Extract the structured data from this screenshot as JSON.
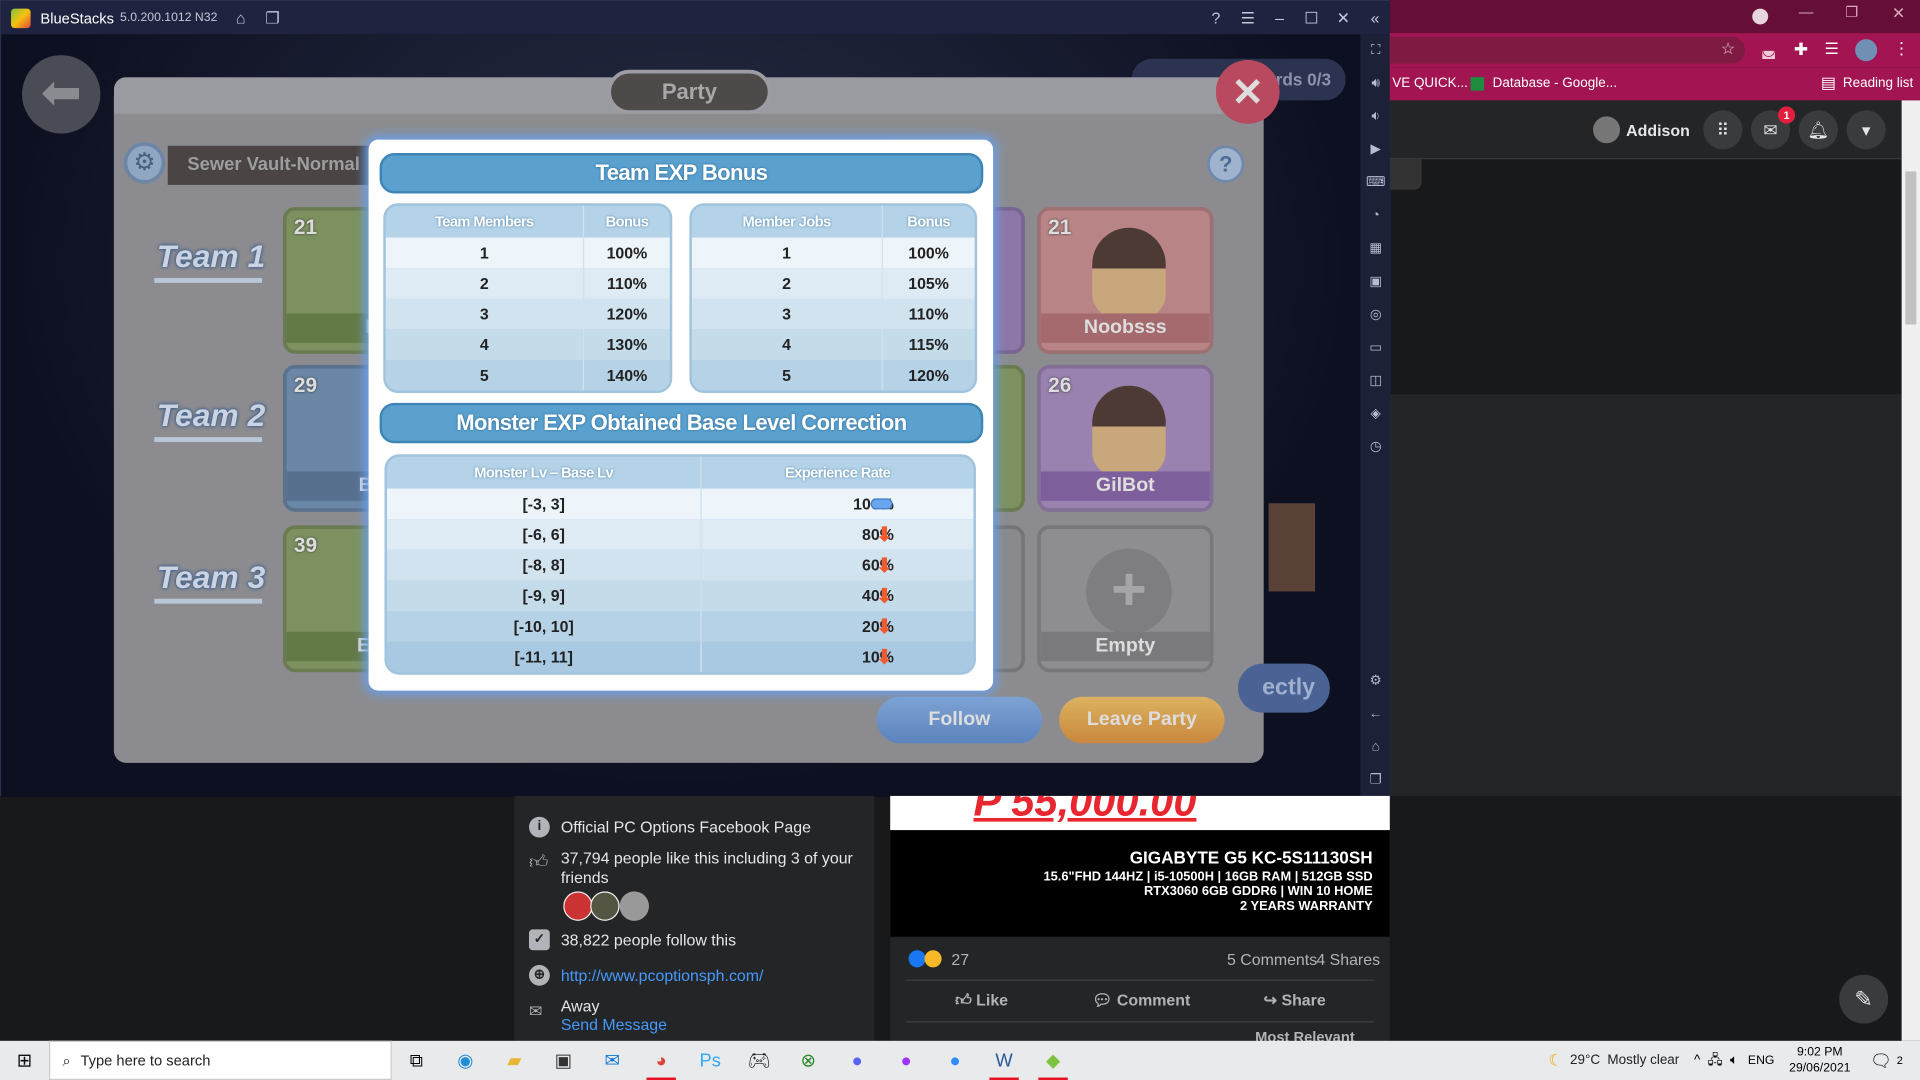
{
  "bluestacks": {
    "app_name": "BlueStacks",
    "version": "5.0.200.1012 N32"
  },
  "game": {
    "title": "Party",
    "dungeon": "Sewer Vault-Normal",
    "rewards": "rds 0/3",
    "teams": [
      "Team 1",
      "Team 2",
      "Team 3"
    ],
    "left_cards": [
      {
        "level": "21",
        "name": "E"
      },
      {
        "level": "29",
        "name": "Bo"
      },
      {
        "level": "39",
        "name": "EM"
      }
    ],
    "right_cards": [
      {
        "level": "21",
        "name": "Noobsss"
      },
      {
        "level": "26",
        "name": "GilBot"
      },
      {
        "level": "",
        "name": "Empty"
      }
    ],
    "follow": "Follow",
    "leave_party": "Leave Party",
    "partial_button": "ectly"
  },
  "modal": {
    "title": "Team EXP Bonus",
    "members_table": {
      "headers": [
        "Team Members",
        "Bonus"
      ],
      "rows": [
        [
          "1",
          "100%"
        ],
        [
          "2",
          "110%"
        ],
        [
          "3",
          "120%"
        ],
        [
          "4",
          "130%"
        ],
        [
          "5",
          "140%"
        ]
      ]
    },
    "jobs_table": {
      "headers": [
        "Member Jobs",
        "Bonus"
      ],
      "rows": [
        [
          "1",
          "100%"
        ],
        [
          "2",
          "105%"
        ],
        [
          "3",
          "110%"
        ],
        [
          "4",
          "115%"
        ],
        [
          "5",
          "120%"
        ]
      ]
    },
    "correction_title": "Monster EXP Obtained Base Level Correction",
    "correction_table": {
      "headers": [
        "Monster Lv – Base Lv",
        "Experience Rate"
      ],
      "rows": [
        {
          "range": "[-3, 3]",
          "rate": "100%",
          "icon": "neutral"
        },
        {
          "range": "[-6, 6]",
          "rate": "80%",
          "icon": "down"
        },
        {
          "range": "[-8, 8]",
          "rate": "60%",
          "icon": "down"
        },
        {
          "range": "[-9, 9]",
          "rate": "40%",
          "icon": "down"
        },
        {
          "range": "[-10, 10]",
          "rate": "20%",
          "icon": "down"
        },
        {
          "range": "[-11, 11]",
          "rate": "10%",
          "icon": "down"
        }
      ]
    }
  },
  "chrome": {
    "bookmarks": [
      "VE QUICK...",
      "Database - Google..."
    ],
    "reading_list": "Reading list"
  },
  "facebook": {
    "user": "Addison",
    "messenger_badge": "1",
    "intro": {
      "page_desc": "Official PC Options Facebook Page",
      "likes": "37,794 people like this including 3 of your friends",
      "follows": "38,822 people follow this",
      "website": "http://www.pcoptionsph.com/",
      "status": "Away",
      "send_message": "Send Message"
    },
    "post": {
      "price": "P 55,000.00",
      "model": "GIGABYTE G5 KC-5S11130SH",
      "spec1": "15.6\"FHD 144HZ  | i5-10500H | 16GB RAM | 512GB SSD",
      "spec2": "RTX3060 6GB GDDR6 | WIN 10 HOME",
      "spec3": "2 YEARS WARRANTY",
      "reactions": "27",
      "comments": "5 Comments",
      "shares": "4 Shares",
      "like": "Like",
      "comment": "Comment",
      "share": "Share",
      "sort": "Most Relevant"
    }
  },
  "taskbar": {
    "search_placeholder": "Type here to search",
    "weather_temp": "29°C",
    "weather_desc": "Mostly clear",
    "lang": "ENG",
    "time": "9:02 PM",
    "date": "29/06/2021",
    "notif_count": "2"
  },
  "colors": {
    "accent_blue": "#5aa1cf",
    "chrome_frame": "#a21452",
    "down_arrow": "#ef5a2e"
  }
}
